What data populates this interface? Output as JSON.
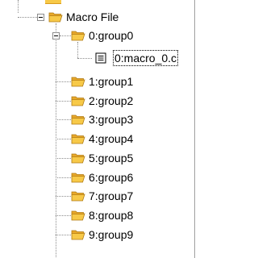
{
  "tree": {
    "root": {
      "label": "Macro File",
      "expanded": true
    },
    "group0": {
      "label": "0:group0",
      "expanded": true,
      "children": [
        {
          "label": "0:macro_0.c"
        }
      ]
    },
    "groups": [
      {
        "label": "1:group1"
      },
      {
        "label": "2:group2"
      },
      {
        "label": "3:group3"
      },
      {
        "label": "4:group4"
      },
      {
        "label": "5:group5"
      },
      {
        "label": "6:group6"
      },
      {
        "label": "7:group7"
      },
      {
        "label": "8:group8"
      },
      {
        "label": "9:group9"
      }
    ]
  },
  "colors": {
    "folder_fill": "#f7c948",
    "folder_dark": "#d99a1c",
    "tree_line": "#8c8c8c"
  },
  "icons": {
    "folder": "folder-icon",
    "file": "file-icon",
    "collapse": "collapse-toggle-icon"
  }
}
